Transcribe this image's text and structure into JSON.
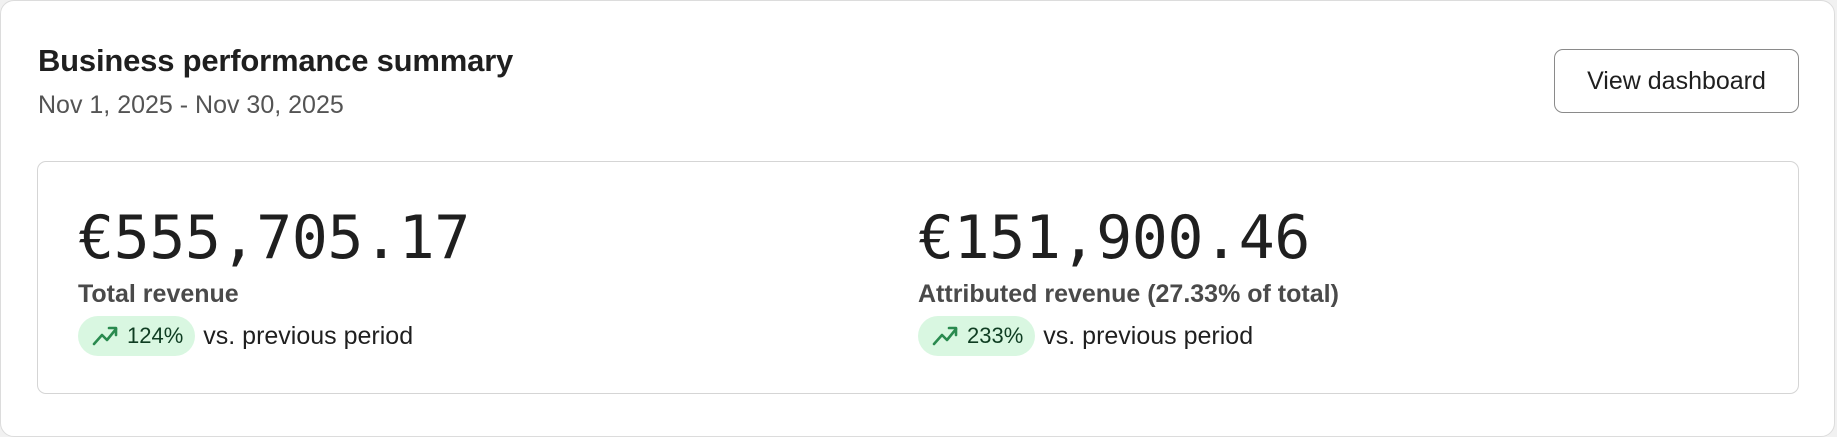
{
  "header": {
    "title": "Business performance summary",
    "date_range": "Nov 1, 2025 - Nov 30, 2025",
    "view_button_label": "View dashboard"
  },
  "metrics": [
    {
      "value": "€555,705.17",
      "label": "Total revenue",
      "change_pct": "124%",
      "change_text": "vs. previous period",
      "change_icon": "trending-up-icon"
    },
    {
      "value": "€151,900.46",
      "label": "Attributed revenue (27.33% of total)",
      "change_pct": "233%",
      "change_text": "vs. previous period",
      "change_icon": "trending-up-icon"
    }
  ],
  "colors": {
    "badge_background": "#d9f7e1",
    "trend_icon": "#2a8a4f",
    "badge_text": "#0f3d22",
    "border": "#d5d5d5"
  }
}
